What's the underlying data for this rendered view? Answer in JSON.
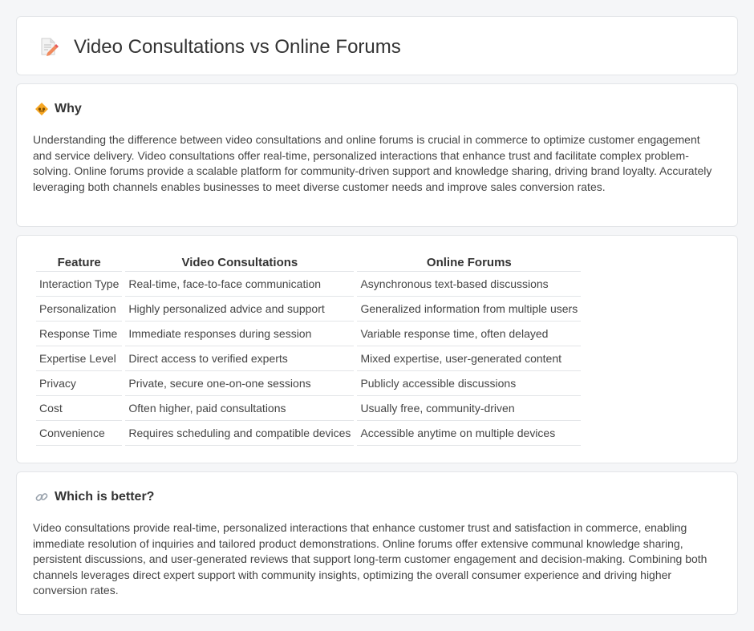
{
  "header": {
    "title": "Video Consultations vs Online Forums",
    "icon": "document-pencil-icon"
  },
  "why": {
    "heading": "Why",
    "icon": "handshake-diamond-icon",
    "text": "Understanding the difference between video consultations and online forums is crucial in commerce to optimize customer engagement and service delivery. Video consultations offer real-time, personalized interactions that enhance trust and facilitate complex problem-solving. Online forums provide a scalable platform for community-driven support and knowledge sharing, driving brand loyalty. Accurately leveraging both channels enables businesses to meet diverse customer needs and improve sales conversion rates."
  },
  "comparison": {
    "headers": [
      "Feature",
      "Video Consultations",
      "Online Forums"
    ],
    "rows": [
      [
        "Interaction Type",
        "Real-time, face-to-face communication",
        "Asynchronous text-based discussions"
      ],
      [
        "Personalization",
        "Highly personalized advice and support",
        "Generalized information from multiple users"
      ],
      [
        "Response Time",
        "Immediate responses during session",
        "Variable response time, often delayed"
      ],
      [
        "Expertise Level",
        "Direct access to verified experts",
        "Mixed expertise, user-generated content"
      ],
      [
        "Privacy",
        "Private, secure one-on-one sessions",
        "Publicly accessible discussions"
      ],
      [
        "Cost",
        "Often higher, paid consultations",
        "Usually free, community-driven"
      ],
      [
        "Convenience",
        "Requires scheduling and compatible devices",
        "Accessible anytime on multiple devices"
      ]
    ]
  },
  "better": {
    "heading": "Which is better?",
    "icon": "link-icon",
    "text": "Video consultations provide real-time, personalized interactions that enhance customer trust and satisfaction in commerce, enabling immediate resolution of inquiries and tailored product demonstrations. Online forums offer extensive communal knowledge sharing, persistent discussions, and user-generated reviews that support long-term customer engagement and decision-making. Combining both channels leverages direct expert support with community insights, optimizing the overall consumer experience and driving higher conversion rates."
  },
  "colors": {
    "background": "#f5f6f8",
    "card": "#ffffff",
    "border": "#e3e5e8",
    "accent_orange": "#f5a623"
  }
}
